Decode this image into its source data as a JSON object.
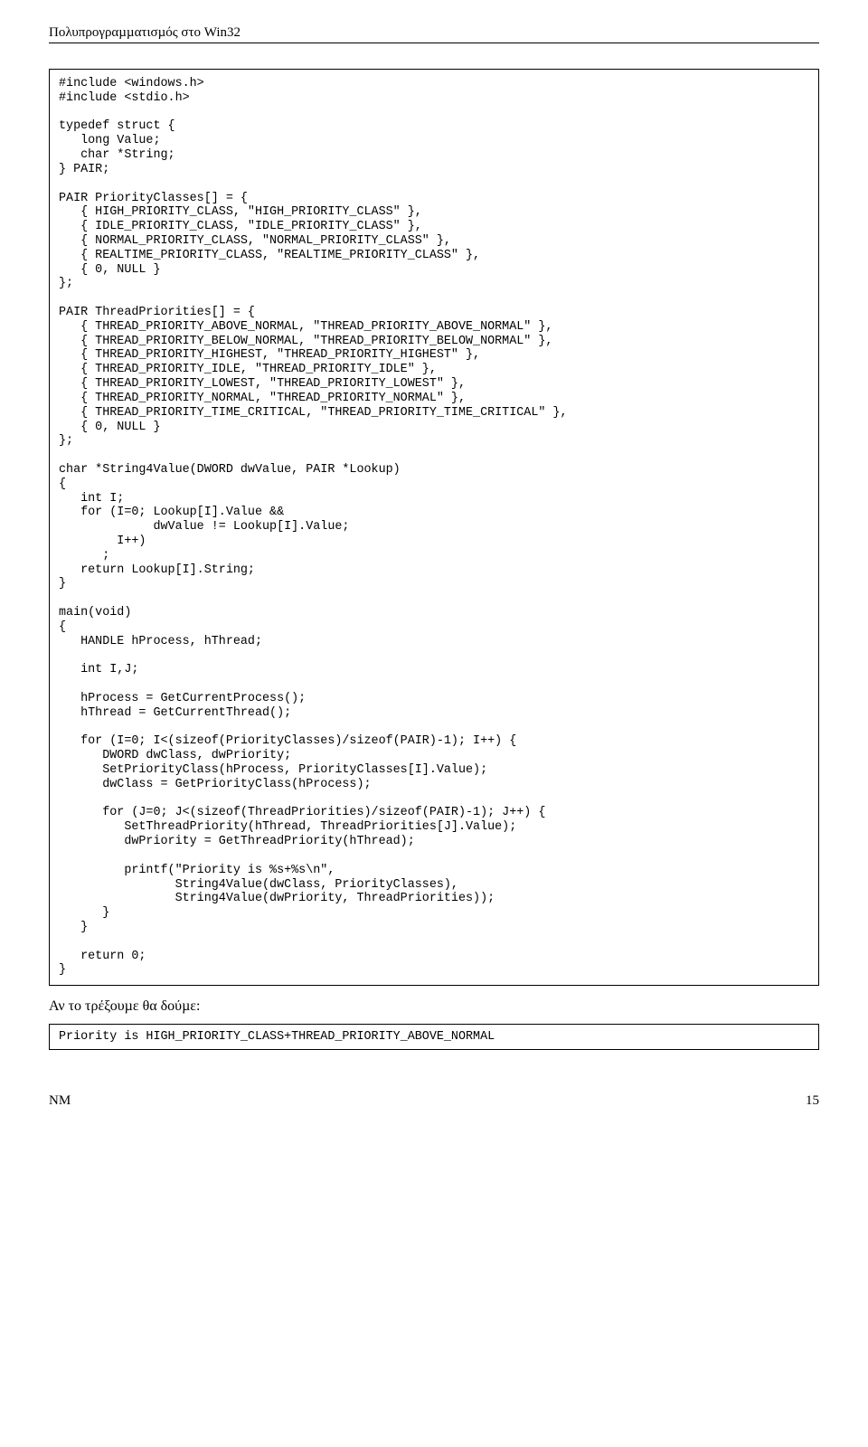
{
  "header": "Πολυπρογραµµατισµός στο Win32",
  "code": "#include <windows.h>\n#include <stdio.h>\n\ntypedef struct {\n   long Value;\n   char *String;\n} PAIR;\n\nPAIR PriorityClasses[] = {\n   { HIGH_PRIORITY_CLASS, \"HIGH_PRIORITY_CLASS\" },\n   { IDLE_PRIORITY_CLASS, \"IDLE_PRIORITY_CLASS\" },\n   { NORMAL_PRIORITY_CLASS, \"NORMAL_PRIORITY_CLASS\" },\n   { REALTIME_PRIORITY_CLASS, \"REALTIME_PRIORITY_CLASS\" },\n   { 0, NULL }\n};\n\nPAIR ThreadPriorities[] = {\n   { THREAD_PRIORITY_ABOVE_NORMAL, \"THREAD_PRIORITY_ABOVE_NORMAL\" },\n   { THREAD_PRIORITY_BELOW_NORMAL, \"THREAD_PRIORITY_BELOW_NORMAL\" },\n   { THREAD_PRIORITY_HIGHEST, \"THREAD_PRIORITY_HIGHEST\" },\n   { THREAD_PRIORITY_IDLE, \"THREAD_PRIORITY_IDLE\" },\n   { THREAD_PRIORITY_LOWEST, \"THREAD_PRIORITY_LOWEST\" },\n   { THREAD_PRIORITY_NORMAL, \"THREAD_PRIORITY_NORMAL\" },\n   { THREAD_PRIORITY_TIME_CRITICAL, \"THREAD_PRIORITY_TIME_CRITICAL\" },\n   { 0, NULL }\n};\n\nchar *String4Value(DWORD dwValue, PAIR *Lookup)\n{\n   int I;\n   for (I=0; Lookup[I].Value &&\n             dwValue != Lookup[I].Value;\n        I++)\n      ;\n   return Lookup[I].String;\n}\n\nmain(void)\n{\n   HANDLE hProcess, hThread;\n\n   int I,J;\n\n   hProcess = GetCurrentProcess();\n   hThread = GetCurrentThread();\n\n   for (I=0; I<(sizeof(PriorityClasses)/sizeof(PAIR)-1); I++) {\n      DWORD dwClass, dwPriority;\n      SetPriorityClass(hProcess, PriorityClasses[I].Value);\n      dwClass = GetPriorityClass(hProcess);\n\n      for (J=0; J<(sizeof(ThreadPriorities)/sizeof(PAIR)-1); J++) {\n         SetThreadPriority(hThread, ThreadPriorities[J].Value);\n         dwPriority = GetThreadPriority(hThread);\n\n         printf(\"Priority is %s+%s\\n\",\n                String4Value(dwClass, PriorityClasses),\n                String4Value(dwPriority, ThreadPriorities));\n      }\n   }\n\n   return 0;\n}",
  "paragraph": "Αν το τρέξουµε θα δούµε:",
  "result": "Priority is HIGH_PRIORITY_CLASS+THREAD_PRIORITY_ABOVE_NORMAL",
  "footer_left": "NM",
  "footer_right": "15"
}
